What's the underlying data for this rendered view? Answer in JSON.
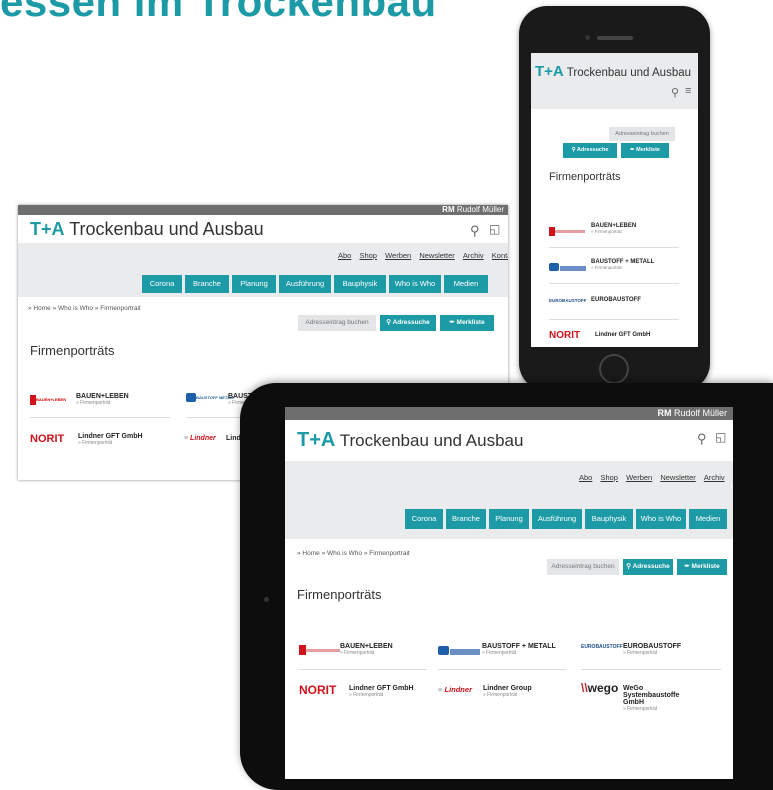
{
  "headline": "essen im Trockenbau",
  "site": {
    "publisher_initials": "RM",
    "publisher_name": "Rudolf Müller",
    "brand_logo": "T+A",
    "brand_name": "Trockenbau und Ausbau",
    "utility_links": [
      "Abo",
      "Shop",
      "Werben",
      "Newsletter",
      "Archiv",
      "Kontakt"
    ],
    "nav": [
      "Corona",
      "Branche",
      "Planung",
      "Ausführung",
      "Bauphysik",
      "Who is Who",
      "Medien"
    ],
    "breadcrumb": "» Home  » Who is Who  » Firmenportrait",
    "breadcrumb_short": "» Home  » Who is Who  » Firmenportrait",
    "btn_address_entry": "Adresseintrag buchen",
    "btn_address_search": "Adressuche",
    "btn_watchlist": "Merkliste",
    "section_title": "Firmenporträts",
    "card_sub": "» Firmenporträt",
    "companies": [
      {
        "name": "BAUEN+LEBEN",
        "logo": "BAUEN+LEBEN"
      },
      {
        "name": "BAUSTOFF + METALL",
        "logo": "BAUSTOFF METALL"
      },
      {
        "name": "EUROBAUSTOFF",
        "logo": "EUROBAUSTOFF"
      },
      {
        "name": "Lindner GFT GmbH",
        "logo": "NORIT"
      },
      {
        "name": "Lindner Group",
        "logo": "Lindner"
      },
      {
        "name": "WeGo Systembaustoffe GmbH",
        "logo": "WEGO"
      }
    ],
    "desktop_companies_partial": [
      "Lind"
    ]
  },
  "colors": {
    "accent": "#1c9aa6",
    "norit": "#d0121b",
    "wego": "#c0292f",
    "rm_bar": "#6e6e6e"
  },
  "icons": [
    "search-icon",
    "lock-icon",
    "menu-icon",
    "pin-icon"
  ]
}
